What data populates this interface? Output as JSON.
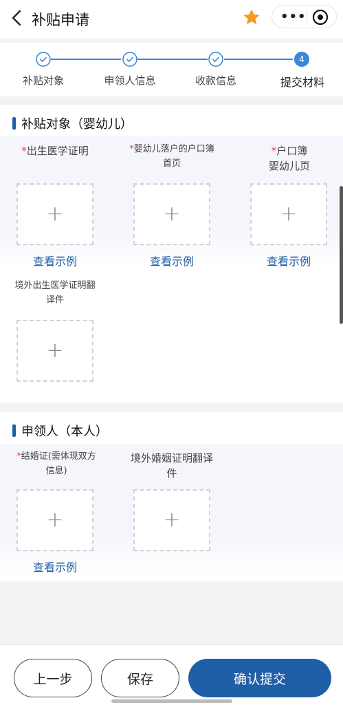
{
  "header": {
    "title": "补贴申请",
    "more_label": "•••"
  },
  "steps": [
    {
      "label": "补贴对象",
      "state": "done"
    },
    {
      "label": "申领人信息",
      "state": "done"
    },
    {
      "label": "收款信息",
      "state": "done"
    },
    {
      "label": "提交材料",
      "state": "current",
      "number": "4"
    }
  ],
  "section1": {
    "title": "补贴对象（婴幼儿）",
    "fields": [
      {
        "required": "*",
        "label_line1": "出生医学证明",
        "label_line2": "",
        "example": "查看示例"
      },
      {
        "required": "*",
        "label_line1": "婴幼儿落户的户口簿",
        "label_line2": "首页",
        "example": "查看示例"
      },
      {
        "required": "*",
        "label_line1": "户口簿",
        "label_line2": "婴幼儿页",
        "example": "查看示例"
      },
      {
        "required": "",
        "label_line1": "境外出生医学证明翻",
        "label_line2": "译件",
        "example": ""
      }
    ]
  },
  "section2": {
    "title": "申领人（本人）",
    "fields": [
      {
        "required": "*",
        "label_line1": "结婚证(需体现双方",
        "label_line2": "信息)",
        "example": "查看示例"
      },
      {
        "required": "",
        "label_line1": "境外婚姻证明翻译",
        "label_line2": "件",
        "example": ""
      }
    ]
  },
  "upload_plus": "+",
  "footer": {
    "prev": "上一步",
    "save": "保存",
    "submit": "确认提交"
  },
  "colors": {
    "accent": "#1f5fa8",
    "required": "#e8453c",
    "star": "#f59a1b"
  }
}
